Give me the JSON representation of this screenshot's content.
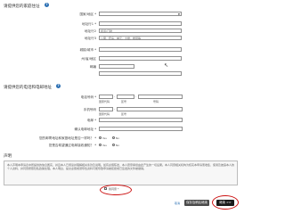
{
  "addr_section": {
    "title": "请提供您的家庭住址",
    "fields": [
      {
        "label": "国家/地区 *",
        "value": "",
        "type": "select"
      },
      {
        "label": "地址行1 *",
        "value": ""
      },
      {
        "label": "地址行2",
        "value": "街道/门牌"
      },
      {
        "label": "地址行3",
        "value": "公寓、套房、单元、大楼、楼层等"
      },
      {
        "label": "城镇/城市 *",
        "value": ""
      },
      {
        "label": "州/省/地区",
        "value": ""
      },
      {
        "label": "邮编",
        "value": ""
      }
    ]
  },
  "contact_section": {
    "title": "请提供您的电话和电邮地址",
    "phone_label": "电话号码 *",
    "phone_sub": [
      "国家代码",
      "区号",
      "号码"
    ],
    "mobile_label": "手机号码",
    "mobile_sub": [
      "国家代码",
      "区号"
    ],
    "email_label": "电邮 *",
    "email_confirm_label": "确认电邮地址 *",
    "q1_label": "您的邮寄地址和家庭地址是否一样吗？ *",
    "q2_label": "您是否希望通过电邮接收通知？ *",
    "yes": "Yes",
    "no": "No"
  },
  "declaration": {
    "title": "声明",
    "text": "本人声明本申请表中所提供的信息属实，并且本人已阅读并理解相关条款及说明。如有虚假陈述，本人愿意承担由此产生的一切后果。本人同意相关机构为核实本申请而收集、使用及披露本人的个人资料，并同意按照隐私政策处理。本人明白，提交虚假或误导性资料可能导致申请被拒绝或已签发的文件被撤销。",
    "agree_label": "我同意 *"
  },
  "buttons": {
    "back": "取消",
    "save": "保存及稍后继续",
    "next": "继续 >>"
  },
  "colors": {
    "help": "#2b6fb3",
    "annotation": "#cc1111",
    "save_btn": "#4a4a4a",
    "next_btn": "#1a1a1a"
  }
}
